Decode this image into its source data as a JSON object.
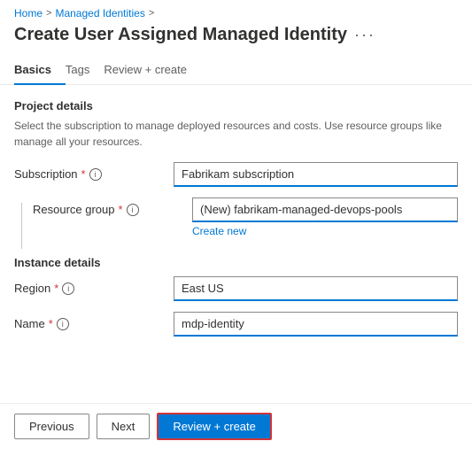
{
  "breadcrumb": {
    "home": "Home",
    "managed_identities": "Managed Identities",
    "sep1": ">",
    "sep2": ">"
  },
  "page": {
    "title": "Create User Assigned Managed Identity",
    "more_icon": "···"
  },
  "tabs": [
    {
      "label": "Basics",
      "active": true
    },
    {
      "label": "Tags",
      "active": false
    },
    {
      "label": "Review + create",
      "active": false
    }
  ],
  "project_details": {
    "section_title": "Project details",
    "description": "Select the subscription to manage deployed resources and costs. Use resource groups like manage all your resources."
  },
  "fields": {
    "subscription_label": "Subscription",
    "subscription_value": "Fabrikam subscription",
    "resource_group_label": "Resource group",
    "resource_group_value": "(New) fabrikam-managed-devops-pools",
    "create_new_label": "Create new",
    "region_label": "Region",
    "region_value": "East US",
    "name_label": "Name",
    "name_value": "mdp-identity"
  },
  "instance_details": {
    "section_title": "Instance details"
  },
  "footer": {
    "previous_label": "Previous",
    "next_label": "Next",
    "review_create_label": "Review + create"
  },
  "icons": {
    "info": "i"
  }
}
